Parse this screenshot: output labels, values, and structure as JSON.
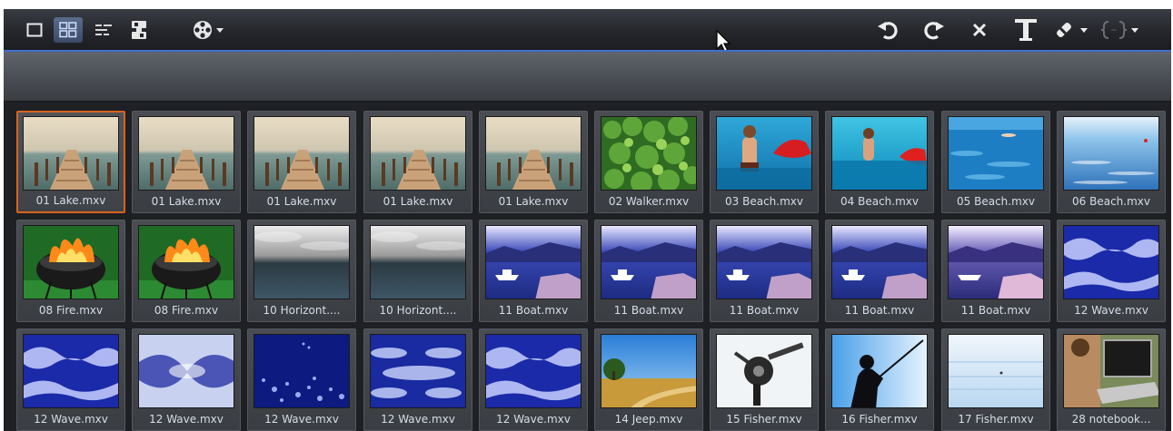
{
  "toolbar": {
    "left_icons": [
      "single-view-icon",
      "grid-view-icon",
      "details-view-icon",
      "video-capture-icon",
      "film-reel-icon"
    ],
    "right_icons": [
      "undo-icon",
      "redo-icon",
      "delete-icon",
      "text-title-icon",
      "brush-icon",
      "effects-icon"
    ]
  },
  "clips": [
    {
      "name": "01 Lake.mxv",
      "kind": "lake",
      "selected": true
    },
    {
      "name": "01 Lake.mxv",
      "kind": "lake"
    },
    {
      "name": "01 Lake.mxv",
      "kind": "lake"
    },
    {
      "name": "01 Lake.mxv",
      "kind": "lake"
    },
    {
      "name": "01 Lake.mxv",
      "kind": "lake"
    },
    {
      "name": "02 Walker.mxv",
      "kind": "walker"
    },
    {
      "name": "03 Beach.mxv",
      "kind": "beach"
    },
    {
      "name": "04 Beach.mxv",
      "kind": "beach2"
    },
    {
      "name": "05 Beach.mxv",
      "kind": "sea"
    },
    {
      "name": "06 Beach.mxv",
      "kind": "sea2"
    },
    {
      "name": "08 Fire.mxv",
      "kind": "fire"
    },
    {
      "name": "08 Fire.mxv",
      "kind": "fire"
    },
    {
      "name": "10 Horizont....",
      "kind": "horizon"
    },
    {
      "name": "10 Horizont....",
      "kind": "horizon"
    },
    {
      "name": "11 Boat.mxv",
      "kind": "boat"
    },
    {
      "name": "11 Boat.mxv",
      "kind": "boat"
    },
    {
      "name": "11 Boat.mxv",
      "kind": "boat"
    },
    {
      "name": "11 Boat.mxv",
      "kind": "boat"
    },
    {
      "name": "11 Boat.mxv",
      "kind": "boat2"
    },
    {
      "name": "12 Wave.mxv",
      "kind": "wave"
    },
    {
      "name": "12 Wave.mxv",
      "kind": "wave"
    },
    {
      "name": "12 Wave.mxv",
      "kind": "wave2"
    },
    {
      "name": "12 Wave.mxv",
      "kind": "wave3"
    },
    {
      "name": "12 Wave.mxv",
      "kind": "wave4"
    },
    {
      "name": "12 Wave.mxv",
      "kind": "wave"
    },
    {
      "name": "14 Jeep.mxv",
      "kind": "jeep"
    },
    {
      "name": "15 Fisher.mxv",
      "kind": "reel"
    },
    {
      "name": "16 Fisher.mxv",
      "kind": "fisher"
    },
    {
      "name": "17 Fisher.mxv",
      "kind": "pale"
    },
    {
      "name": "28 notebook...",
      "kind": "notebook"
    }
  ]
}
